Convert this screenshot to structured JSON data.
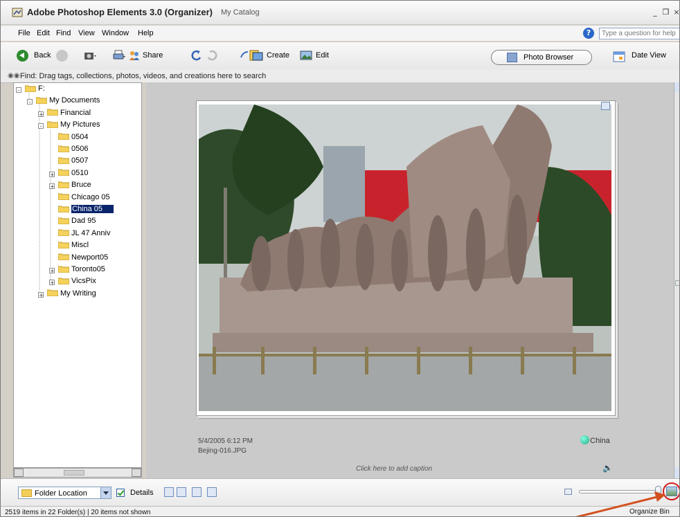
{
  "window": {
    "title": "Adobe Photoshop Elements 3.0 (Organizer)",
    "subtitle": "My Catalog",
    "controls": [
      "_",
      "❒",
      "×"
    ]
  },
  "menu": {
    "items": [
      "File",
      "Edit",
      "Find",
      "View",
      "Window",
      "Help"
    ],
    "help_placeholder": "Type a question for help"
  },
  "toolbar": {
    "back": "Back",
    "share": "Share",
    "create": "Create",
    "edit": "Edit",
    "photo_browser": "Photo Browser",
    "date_view": "Date View"
  },
  "find_bar": {
    "text": "Find: Drag tags, collections, photos, videos, and creations here to search"
  },
  "tree": {
    "items": [
      {
        "label": "F:",
        "depth": 0,
        "expander": "-"
      },
      {
        "label": "My Documents",
        "depth": 1,
        "expander": "-"
      },
      {
        "label": "Financial",
        "depth": 2,
        "expander": "+"
      },
      {
        "label": "My Pictures",
        "depth": 2,
        "expander": "-"
      },
      {
        "label": "0504",
        "depth": 3,
        "expander": ""
      },
      {
        "label": "0506",
        "depth": 3,
        "expander": ""
      },
      {
        "label": "0507",
        "depth": 3,
        "expander": ""
      },
      {
        "label": "0510",
        "depth": 3,
        "expander": "+"
      },
      {
        "label": "Bruce",
        "depth": 3,
        "expander": "+"
      },
      {
        "label": "Chicago 05",
        "depth": 3,
        "expander": ""
      },
      {
        "label": "China 05",
        "depth": 3,
        "expander": "",
        "selected": true
      },
      {
        "label": "Dad 95",
        "depth": 3,
        "expander": ""
      },
      {
        "label": "JL 47 Anniv",
        "depth": 3,
        "expander": ""
      },
      {
        "label": "Miscl",
        "depth": 3,
        "expander": ""
      },
      {
        "label": "Newport05",
        "depth": 3,
        "expander": ""
      },
      {
        "label": "Toronto05",
        "depth": 3,
        "expander": "+"
      },
      {
        "label": "VicsPix",
        "depth": 3,
        "expander": "+"
      },
      {
        "label": "My Writing",
        "depth": 2,
        "expander": "+"
      }
    ]
  },
  "photo": {
    "date": "5/4/2005 6:12 PM",
    "filename": "Bejing-016.JPG",
    "tag": "China",
    "caption_placeholder": "Click here to add caption"
  },
  "bottom": {
    "folder_location": "Folder Location",
    "details_label": "Details",
    "details_checked": true
  },
  "status": {
    "text": "2519 items in 22 Folder(s)  |  20 items not shown",
    "organize_bin": "Organize Bin"
  },
  "colors": {
    "selection": "#0a246a",
    "annotation_red": "#d41c1c",
    "annotation_arrow": "#d2501e"
  }
}
